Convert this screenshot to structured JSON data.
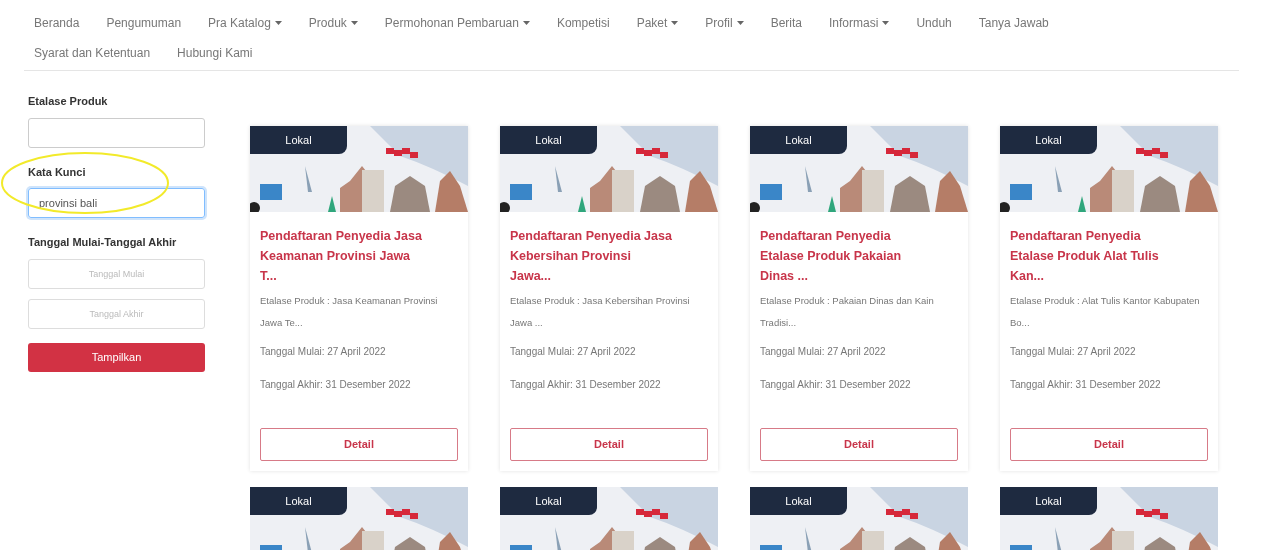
{
  "nav": [
    {
      "label": "Beranda",
      "dropdown": false
    },
    {
      "label": "Pengumuman",
      "dropdown": false
    },
    {
      "label": "Pra Katalog",
      "dropdown": true
    },
    {
      "label": "Produk",
      "dropdown": true
    },
    {
      "label": "Permohonan Pembaruan",
      "dropdown": true
    },
    {
      "label": "Kompetisi",
      "dropdown": false
    },
    {
      "label": "Paket",
      "dropdown": true
    },
    {
      "label": "Profil",
      "dropdown": true
    },
    {
      "label": "Berita",
      "dropdown": false
    },
    {
      "label": "Informasi",
      "dropdown": true
    },
    {
      "label": "Unduh",
      "dropdown": false
    },
    {
      "label": "Tanya Jawab",
      "dropdown": false
    },
    {
      "label": "Syarat dan Ketentuan",
      "dropdown": false
    },
    {
      "label": "Hubungi Kami",
      "dropdown": false
    }
  ],
  "filters": {
    "etalase": {
      "label": "Etalase Produk"
    },
    "keyword": {
      "label": "Kata Kunci",
      "value": "provinsi bali",
      "focused": true
    },
    "dates": {
      "label": "Tanggal Mulai-Tanggal Akhir",
      "start_placeholder": "Tanggal Mulai",
      "end_placeholder": "Tanggal Akhir"
    },
    "submit": "Tampilkan"
  },
  "cards": [
    {
      "badge": "Lokal",
      "title": "Pendaftaran Penyedia Jasa Keamanan Provinsi Jawa T...",
      "etalase": "Etalase Produk : Jasa Keamanan Provinsi Jawa Te...",
      "start": "Tanggal Mulai: 27 April 2022",
      "end": "Tanggal Akhir: 31 Desember 2022",
      "button": "Detail"
    },
    {
      "badge": "Lokal",
      "title": "Pendaftaran Penyedia Jasa Kebersihan Provinsi Jawa...",
      "etalase": "Etalase Produk : Jasa Kebersihan Provinsi Jawa ...",
      "start": "Tanggal Mulai: 27 April 2022",
      "end": "Tanggal Akhir: 31 Desember 2022",
      "button": "Detail"
    },
    {
      "badge": "Lokal",
      "title": "Pendaftaran Penyedia Etalase Produk Pakaian Dinas ...",
      "etalase": "Etalase Produk : Pakaian Dinas dan Kain Tradisi...",
      "start": "Tanggal Mulai: 27 April 2022",
      "end": "Tanggal Akhir: 31 Desember 2022",
      "button": "Detail"
    },
    {
      "badge": "Lokal",
      "title": "Pendaftaran Penyedia Etalase Produk Alat Tulis Kan...",
      "etalase": "Etalase Produk : Alat Tulis Kantor Kabupaten Bo...",
      "start": "Tanggal Mulai: 27 April 2022",
      "end": "Tanggal Akhir: 31 Desember 2022",
      "button": "Detail"
    }
  ],
  "more_cards": [
    {
      "badge": "Lokal"
    },
    {
      "badge": "Lokal"
    },
    {
      "badge": "Lokal"
    },
    {
      "badge": "Lokal"
    }
  ]
}
